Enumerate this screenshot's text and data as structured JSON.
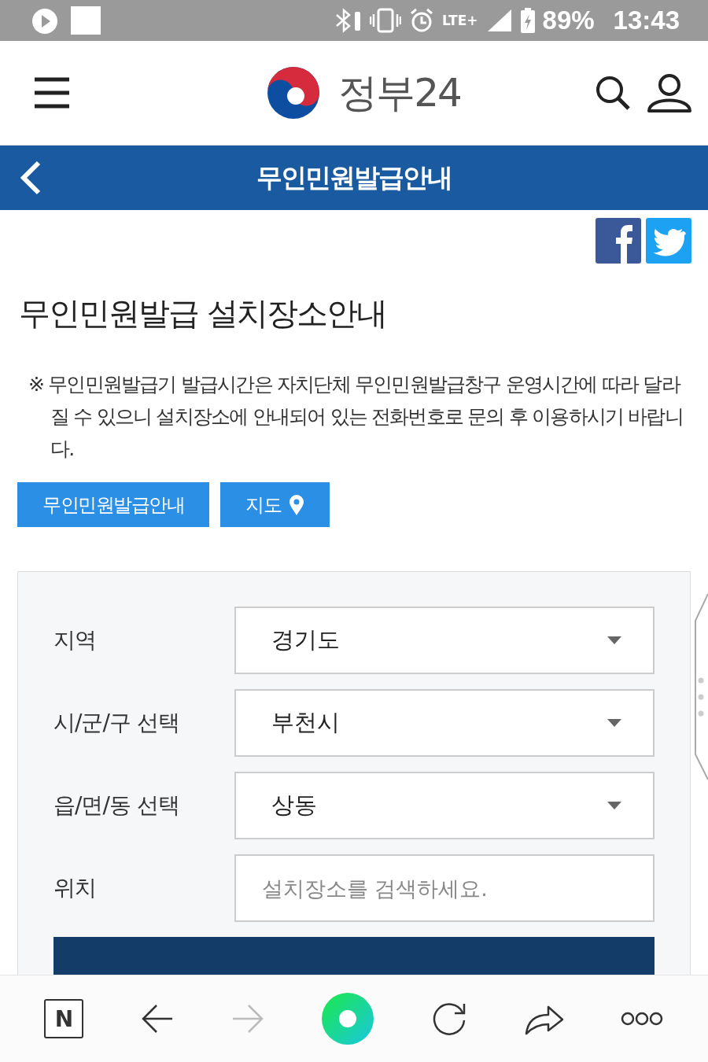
{
  "status_bar": {
    "network": "LTE+",
    "battery": "89%",
    "time": "13:43"
  },
  "header": {
    "logo_text": "정부24"
  },
  "title_bar": {
    "title": "무인민원발급안내"
  },
  "page": {
    "heading": "무인민원발급 설치장소안내",
    "notice": "※ 무인민원발급기 발급시간은 자치단체 무인민원발급창구 운영시간에 따라 달라질 수 있으니 설치장소에 안내되어 있는 전화번호로 문의 후 이용하시기 바랍니다."
  },
  "tabs": [
    {
      "label": "무인민원발급안내",
      "kind": "plain"
    },
    {
      "label": "지도",
      "kind": "map"
    }
  ],
  "form": {
    "fields": [
      {
        "label": "지역",
        "kind": "select",
        "value": "경기도"
      },
      {
        "label": "시/군/구 선택",
        "kind": "select",
        "value": "부천시"
      },
      {
        "label": "읍/면/동 선택",
        "kind": "select",
        "value": "상동"
      },
      {
        "label": "위치",
        "kind": "text",
        "placeholder": "설치장소를 검색하세요."
      }
    ]
  },
  "browser_bar": {
    "home_label": "N",
    "forward_disabled": true
  }
}
